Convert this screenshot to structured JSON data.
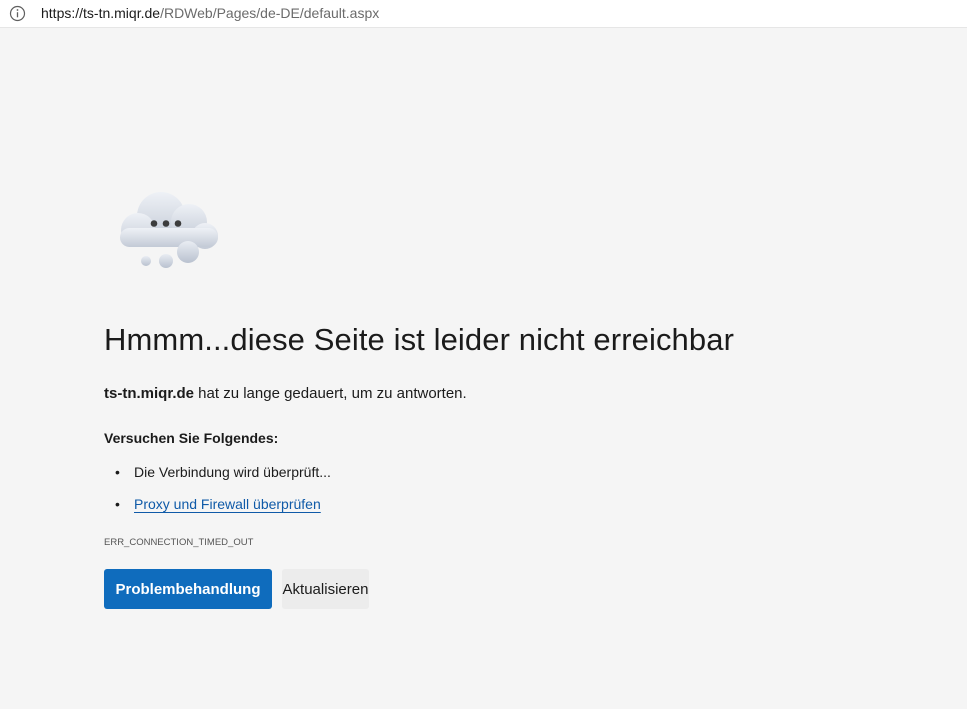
{
  "address_bar": {
    "url_host": "https://ts-tn.miqr.de",
    "url_path": "/RDWeb/Pages/de-DE/default.aspx",
    "info_icon": "info-circle-icon"
  },
  "illustration": {
    "icon": "cloud-dots-icon"
  },
  "error": {
    "heading": "Hmmm...diese Seite ist leider nicht erreichbar",
    "host": "ts-tn.miqr.de",
    "message": " hat zu lange gedauert, um zu antworten.",
    "suggestions_title": "Versuchen Sie Folgendes:",
    "suggestions": [
      {
        "bullet": "•",
        "text": "Die Verbindung wird überprüft..."
      },
      {
        "bullet": "•",
        "text": "Proxy und Firewall überprüfen"
      }
    ],
    "code": "ERR_CONNECTION_TIMED_OUT"
  },
  "buttons": {
    "troubleshoot": "Problembehandlung",
    "refresh": "Aktualisieren"
  },
  "colors": {
    "primary": "#0f6cbd",
    "link": "#0f5aa8",
    "background": "#f5f5f5"
  }
}
